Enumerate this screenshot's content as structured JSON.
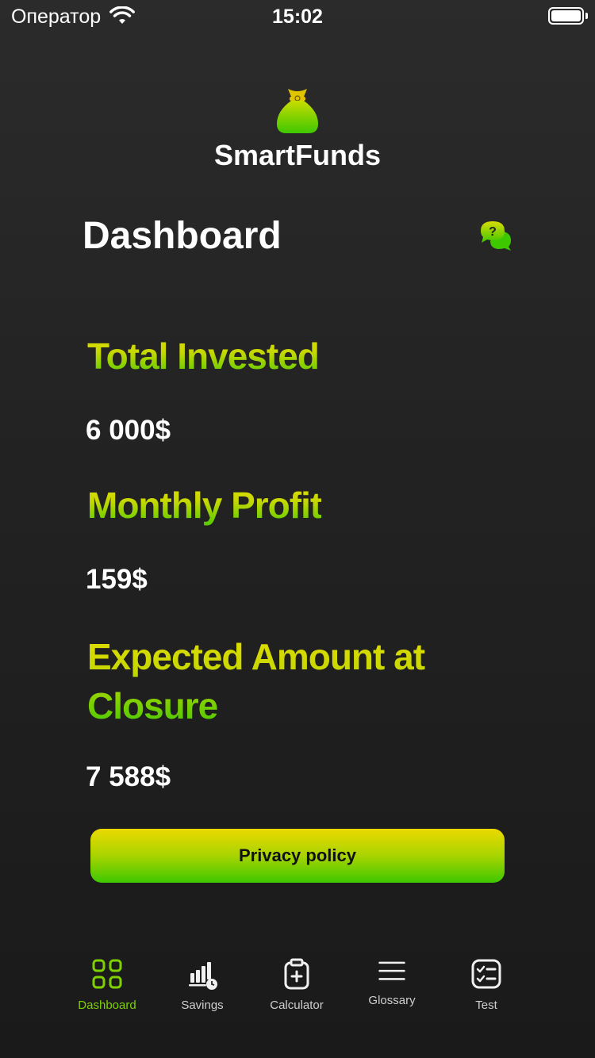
{
  "status_bar": {
    "carrier": "Оператор",
    "time": "15:02"
  },
  "app": {
    "name": "SmartFunds",
    "logo_icon": "money-bag-icon"
  },
  "header": {
    "title": "Dashboard",
    "help_icon": "help-chat-icon"
  },
  "stats": [
    {
      "label": "Total Invested",
      "value": "6 000$"
    },
    {
      "label": "Monthly Profit",
      "value": "159$"
    },
    {
      "label": "Expected Amount at Closure",
      "value": "7 588$"
    }
  ],
  "privacy_button": {
    "label": "Privacy policy"
  },
  "tab_bar": {
    "items": [
      {
        "label": "Dashboard",
        "icon": "grid-icon",
        "active": true
      },
      {
        "label": "Savings",
        "icon": "bar-chart-icon",
        "active": false
      },
      {
        "label": "Calculator",
        "icon": "clipboard-plus-icon",
        "active": false
      },
      {
        "label": "Glossary",
        "icon": "menu-lines-icon",
        "active": false
      },
      {
        "label": "Test",
        "icon": "checklist-icon",
        "active": false
      }
    ]
  },
  "colors": {
    "accent_green": "#3ec800",
    "accent_yellow": "#ecd900",
    "background": "#222222"
  }
}
